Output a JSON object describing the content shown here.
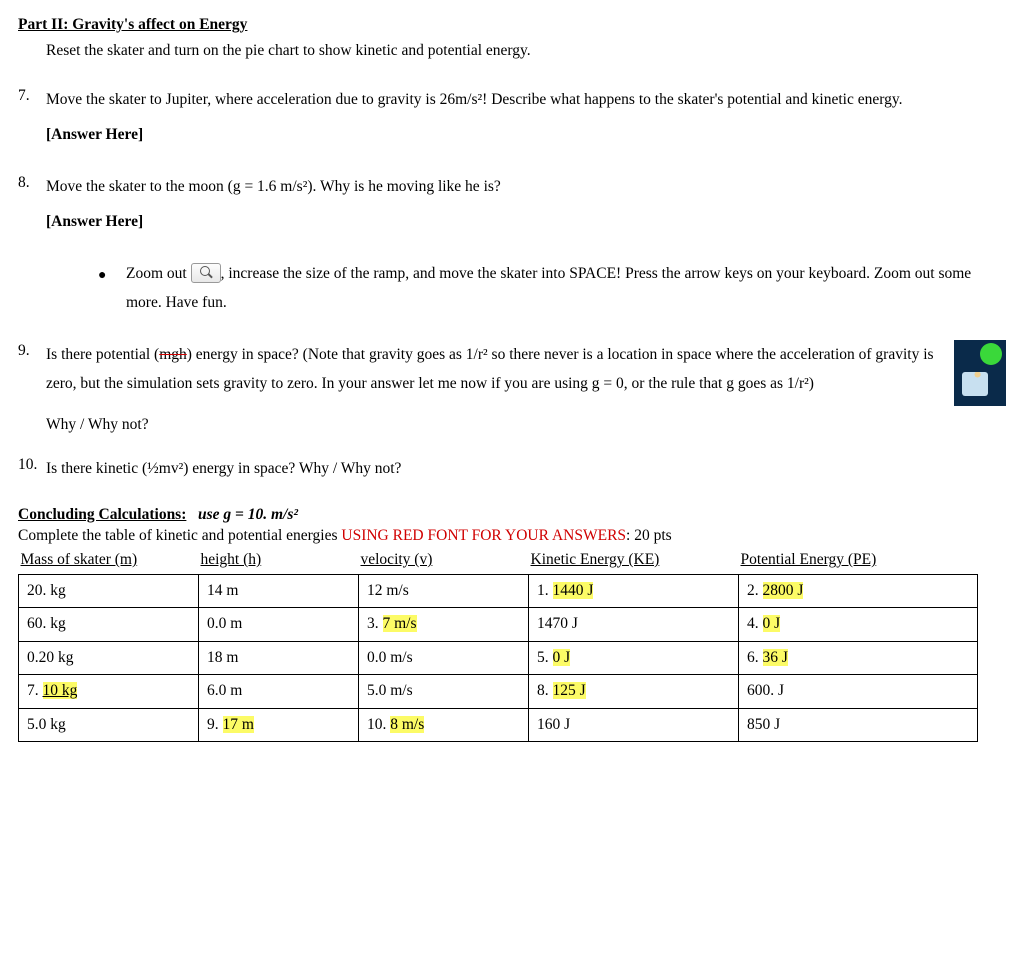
{
  "title": "Part II: Gravity's affect on Energy",
  "intro": "Reset the skater and turn on the pie chart to show kinetic and potential energy.",
  "q7": {
    "num": "7.",
    "text": "Move the skater to Jupiter, where acceleration due to gravity is 26m/s²!  Describe what happens to the skater's potential and kinetic energy.",
    "answer_label": "[Answer Here]"
  },
  "q8": {
    "num": "8.",
    "text": "Move the skater to the moon (g = 1.6 m/s²).  Why is he moving like he is?",
    "answer_label": "[Answer Here]"
  },
  "bullet": {
    "pre": "Zoom out ",
    "post": ", increase the size of the ramp, and move the skater into SPACE!  Press the arrow keys on your keyboard.  Zoom out some more.  Have fun."
  },
  "q9": {
    "num": "9.",
    "line1a": "Is there potential (",
    "mgh": "mgh",
    "line1b": ") energy in space?  (Note that gravity goes as 1/r² so there never is a location in space where the acceleration of gravity is zero, but the simulation sets gravity to zero.  In your answer let me now if you are using g = 0, or the rule that g goes as 1/r²)",
    "why": "Why / Why not?"
  },
  "q10": {
    "num": "10.",
    "text": "Is there kinetic (½mv²) energy in space?  Why / Why not?"
  },
  "conclude": {
    "head": "Concluding Calculations:",
    "use": "use g = 10. m/s²",
    "line2a": "Complete the table of kinetic and potential energies ",
    "line2b": "USING RED FONT FOR YOUR ANSWERS",
    "line2c": ": 20 pts"
  },
  "headers": {
    "mass": "Mass of skater (m)",
    "height": "height (h)",
    "velocity": "velocity (v)",
    "ke": "Kinetic Energy (KE)",
    "pe": "Potential Energy (PE)"
  },
  "rows": [
    {
      "mass": "20. kg",
      "height": "14 m",
      "velocity": "12 m/s",
      "ke_n": "1.",
      "ke_v": "1440 J",
      "ke_hl": true,
      "pe_n": "2.",
      "pe_v": "2800 J",
      "pe_hl": true
    },
    {
      "mass": "60. kg",
      "height": "0.0 m",
      "v_n": "3.",
      "v_v": "7 m/s",
      "v_hl": true,
      "ke_plain": "1470 J",
      "pe_n": "4.",
      "pe_v": "0 J",
      "pe_hl": true
    },
    {
      "mass": "0.20 kg",
      "height": "18 m",
      "velocity": "0.0 m/s",
      "ke_n": "5.",
      "ke_v": "0 J",
      "ke_hl": true,
      "pe_n": "6.",
      "pe_v": "36 J",
      "pe_hl": true
    },
    {
      "m_n": "7.",
      "m_v": "10  kg",
      "m_hl": true,
      "m_ul": true,
      "height": "6.0 m",
      "velocity": "5.0 m/s",
      "ke_n": "8.",
      "ke_v": "125 J",
      "ke_hl": true,
      "pe_plain": "600. J"
    },
    {
      "mass": "5.0 kg",
      "h_n": "9.",
      "h_v": "17 m",
      "h_hl": true,
      "v_n": "10.",
      "v_v": "8 m/s",
      "v_hl": true,
      "ke_plain": "160 J",
      "pe_plain": "850 J"
    }
  ]
}
